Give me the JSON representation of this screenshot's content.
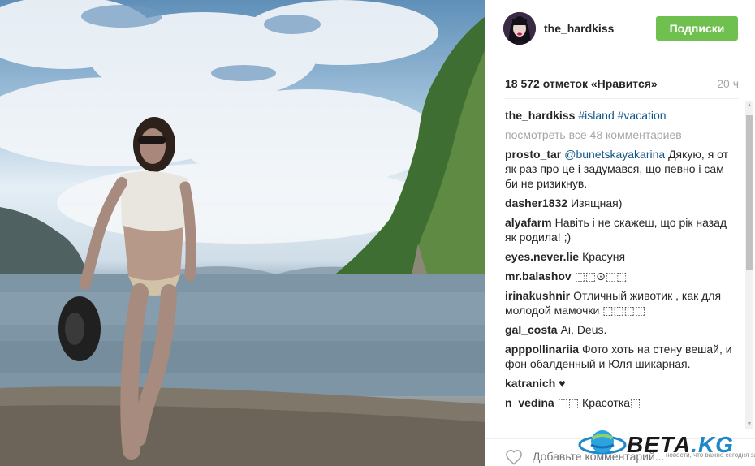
{
  "post": {
    "username": "the_hardkiss",
    "follow_label": "Подписки",
    "likes": "18 572 отметок «Нравится»",
    "time": "20 ч"
  },
  "caption": {
    "user": "the_hardkiss",
    "tags": "#island #vacation"
  },
  "view_all": "посмотреть все 48 комментариев",
  "comments": [
    {
      "user": "prosto_tar",
      "mention": "@bunetskayakarina",
      "text": "Дякую, я от як раз про це і задумався, що певно і сам би не ризикнув."
    },
    {
      "user": "dasher1832",
      "mention": "",
      "text": "Изящная)"
    },
    {
      "user": "alyafarm",
      "mention": "",
      "text": "Навіть і не скажеш, що рік назад як родила! ;)"
    },
    {
      "user": "eyes.never.lie",
      "mention": "",
      "text": "Красуня"
    },
    {
      "user": "mr.balashov",
      "mention": "",
      "text": "⬚⬚⊙⬚⬚"
    },
    {
      "user": "irinakushnir",
      "mention": "",
      "text": "Отличный животик , как для молодой мамочки ⬚⬚⬚⬚"
    },
    {
      "user": "gal_costa",
      "mention": "",
      "text": "Ai, Deus."
    },
    {
      "user": "apppollinariia",
      "mention": "",
      "text": "Фото хоть на стену вешай, и фон обалденный и Юля шикарная."
    },
    {
      "user": "katranich",
      "mention": "",
      "text": "♥"
    },
    {
      "user": "n_vedina",
      "mention": "",
      "text": "⬚⬚ Красотка⬚"
    }
  ],
  "footer": {
    "add_comment_placeholder": "Добавьте комментарий..."
  },
  "watermark": {
    "brand": "ВЕТА",
    "domain": ".KG",
    "subtitle": "новости, что важно сегодня завтра"
  },
  "colors": {
    "follow_green": "#70c050",
    "link_blue": "#125688",
    "muted_gray": "#a5a7aa"
  }
}
